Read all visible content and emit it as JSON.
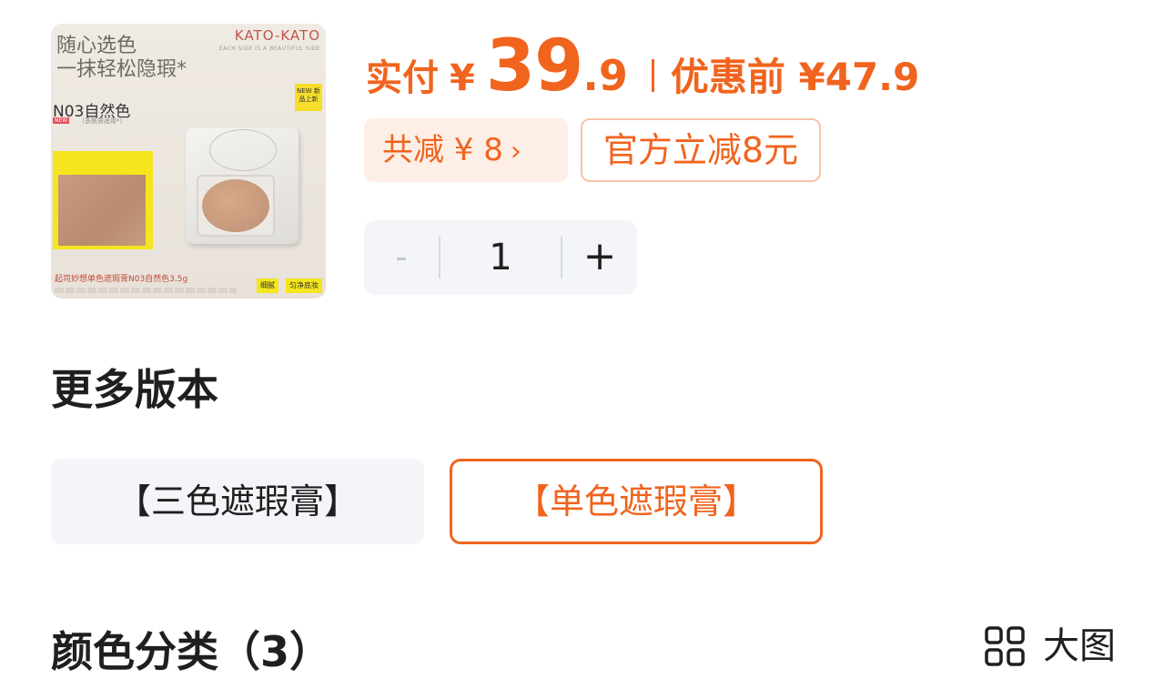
{
  "product": {
    "image_text": {
      "slogan_line1": "随心选色",
      "slogan_line2": "一抹轻松隐瑕*",
      "brand": "KATO-KATO",
      "brand_sub": "EACH SIDE IS A BEAUTIFUL SIDE",
      "new_badge": "NEW 新品上新",
      "shade": "N03自然色",
      "mini_new": "NEW",
      "shade_note": "（多肤质适用*）",
      "caption": "起司妙想单色遮瑕膏N03自然色3.5g",
      "tag1": "细腻",
      "tag2": "匀净底妆"
    }
  },
  "price": {
    "label": "实付",
    "currency": "¥",
    "integer": "39",
    "decimal": ".9",
    "original": "优惠前 ¥47.9"
  },
  "discounts": {
    "total": "共减 ¥ 8",
    "total_chevron": "›",
    "official": "官方立减8元"
  },
  "quantity": {
    "minus": "-",
    "value": "1",
    "plus": "+"
  },
  "versions": {
    "title": "更多版本",
    "options": [
      {
        "label": "【三色遮瑕膏】",
        "selected": false
      },
      {
        "label": "【单色遮瑕膏】",
        "selected": true
      }
    ]
  },
  "colors": {
    "title": "颜色分类（3）",
    "big_view_label": "大图",
    "big_view_icon": "grid-icon"
  },
  "theme": {
    "accent": "#f0641e",
    "accent_light_bg": "#fdeee6",
    "neutral_bg": "#f3f5f8"
  }
}
